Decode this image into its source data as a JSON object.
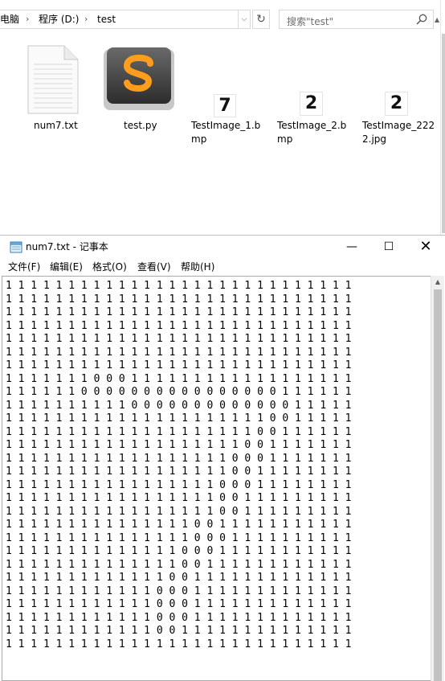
{
  "explorer": {
    "breadcrumb": [
      "电脑",
      "程序 (D:)",
      "test"
    ],
    "search_placeholder": "搜索\"test\"",
    "files": [
      {
        "name_lines": [
          "num7.txt"
        ],
        "icon": "text-file-icon"
      },
      {
        "name_lines": [
          "test.py"
        ],
        "icon": "sublime-text-icon"
      },
      {
        "name_lines": [
          "TestImage_1.b",
          "mp"
        ],
        "icon": "image-thumbnail",
        "thumb_text": "7"
      },
      {
        "name_lines": [
          "TestImage_2.b",
          "mp"
        ],
        "icon": "image-thumbnail",
        "thumb_text": "2"
      },
      {
        "name_lines": [
          "TestImage_222",
          "2.jpg"
        ],
        "icon": "image-thumbnail",
        "thumb_text": "2"
      }
    ]
  },
  "notepad": {
    "title": "num7.txt - 记事本",
    "menu": [
      "文件(F)",
      "编辑(E)",
      "格式(O)",
      "查看(V)",
      "帮助(H)"
    ],
    "lines": [
      "1 1 1 1 1 1 1 1 1 1 1 1 1 1 1 1 1 1 1 1 1 1 1 1 1 1 1 1",
      "1 1 1 1 1 1 1 1 1 1 1 1 1 1 1 1 1 1 1 1 1 1 1 1 1 1 1 1",
      "1 1 1 1 1 1 1 1 1 1 1 1 1 1 1 1 1 1 1 1 1 1 1 1 1 1 1 1",
      "1 1 1 1 1 1 1 1 1 1 1 1 1 1 1 1 1 1 1 1 1 1 1 1 1 1 1 1",
      "1 1 1 1 1 1 1 1 1 1 1 1 1 1 1 1 1 1 1 1 1 1 1 1 1 1 1 1",
      "1 1 1 1 1 1 1 1 1 1 1 1 1 1 1 1 1 1 1 1 1 1 1 1 1 1 1 1",
      "1 1 1 1 1 1 1 1 1 1 1 1 1 1 1 1 1 1 1 1 1 1 1 1 1 1 1 1",
      "1 1 1 1 1 1 1 0 0 0 1 1 1 1 1 1 1 1 1 1 1 1 1 1 1 1 1 1",
      "1 1 1 1 1 1 0 0 0 0 0 0 0 0 0 0 0 0 0 0 0 0 1 1 1 1 1 1",
      "1 1 1 1 1 1 1 1 1 1 0 0 0 0 0 0 0 0 0 0 0 0 0 1 1 1 1 1",
      "1 1 1 1 1 1 1 1 1 1 1 1 1 1 1 1 1 1 1 1 1 0 0 1 1 1 1 1",
      "1 1 1 1 1 1 1 1 1 1 1 1 1 1 1 1 1 1 1 1 0 0 1 1 1 1 1 1",
      "1 1 1 1 1 1 1 1 1 1 1 1 1 1 1 1 1 1 1 0 0 1 1 1 1 1 1 1",
      "1 1 1 1 1 1 1 1 1 1 1 1 1 1 1 1 1 1 0 0 0 1 1 1 1 1 1 1",
      "1 1 1 1 1 1 1 1 1 1 1 1 1 1 1 1 1 1 0 0 1 1 1 1 1 1 1 1",
      "1 1 1 1 1 1 1 1 1 1 1 1 1 1 1 1 1 0 0 0 1 1 1 1 1 1 1 1",
      "1 1 1 1 1 1 1 1 1 1 1 1 1 1 1 1 1 0 0 1 1 1 1 1 1 1 1 1",
      "1 1 1 1 1 1 1 1 1 1 1 1 1 1 1 1 1 0 0 1 1 1 1 1 1 1 1 1",
      "1 1 1 1 1 1 1 1 1 1 1 1 1 1 1 0 0 1 1 1 1 1 1 1 1 1 1 1",
      "1 1 1 1 1 1 1 1 1 1 1 1 1 1 1 0 0 0 1 1 1 1 1 1 1 1 1 1",
      "1 1 1 1 1 1 1 1 1 1 1 1 1 1 0 0 0 1 1 1 1 1 1 1 1 1 1 1",
      "1 1 1 1 1 1 1 1 1 1 1 1 1 1 0 0 1 1 1 1 1 1 1 1 1 1 1 1",
      "1 1 1 1 1 1 1 1 1 1 1 1 1 0 0 1 1 1 1 1 1 1 1 1 1 1 1 1",
      "1 1 1 1 1 1 1 1 1 1 1 1 0 0 0 1 1 1 1 1 1 1 1 1 1 1 1 1",
      "1 1 1 1 1 1 1 1 1 1 1 1 0 0 0 1 1 1 1 1 1 1 1 1 1 1 1 1",
      "1 1 1 1 1 1 1 1 1 1 1 1 0 0 0 1 1 1 1 1 1 1 1 1 1 1 1 1",
      "1 1 1 1 1 1 1 1 1 1 1 1 0 0 1 1 1 1 1 1 1 1 1 1 1 1 1 1",
      "1 1 1 1 1 1 1 1 1 1 1 1 1 1 1 1 1 1 1 1 1 1 1 1 1 1 1 1"
    ]
  }
}
